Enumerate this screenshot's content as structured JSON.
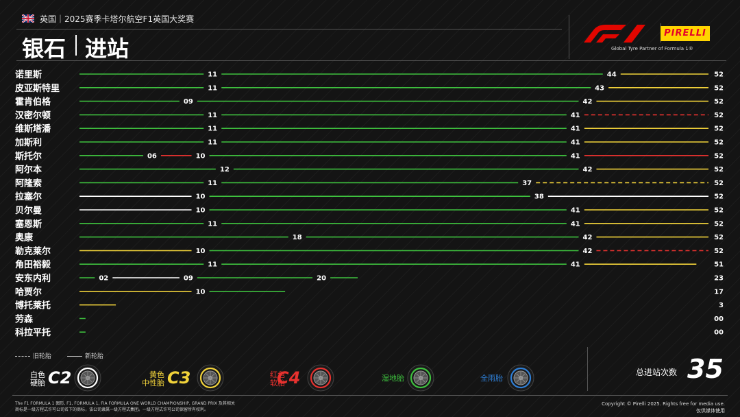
{
  "header": {
    "subtitle": "英国｜2025赛季卡塔尔航空F1英国大奖赛",
    "title_left": "银石",
    "title_right": "进站",
    "partner_text": "Global Tyre Partner of Formula 1®",
    "pirelli_text": "PIRELLI"
  },
  "colors": {
    "hard": "#ffffff",
    "medium": "#f2d33a",
    "soft": "#e8322f",
    "intermediate": "#3ec13e",
    "wet": "#2f7fd6"
  },
  "chart_data": {
    "type": "bar",
    "total_laps": 52,
    "drivers": [
      {
        "name": "诺里斯",
        "end": "52",
        "stints": [
          {
            "from": 0,
            "to": 11,
            "compound": "intermediate",
            "used": false
          },
          {
            "from": 11,
            "to": 44,
            "compound": "intermediate",
            "used": false
          },
          {
            "from": 44,
            "to": 52,
            "compound": "medium",
            "used": false
          }
        ],
        "marks": [
          "11",
          "44"
        ]
      },
      {
        "name": "皮亚斯特里",
        "end": "52",
        "stints": [
          {
            "from": 0,
            "to": 11,
            "compound": "intermediate",
            "used": false
          },
          {
            "from": 11,
            "to": 43,
            "compound": "intermediate",
            "used": false
          },
          {
            "from": 43,
            "to": 52,
            "compound": "medium",
            "used": false
          }
        ],
        "marks": [
          "11",
          "43"
        ]
      },
      {
        "name": "霍肯伯格",
        "end": "52",
        "stints": [
          {
            "from": 0,
            "to": 9,
            "compound": "intermediate",
            "used": false
          },
          {
            "from": 9,
            "to": 42,
            "compound": "intermediate",
            "used": false
          },
          {
            "from": 42,
            "to": 52,
            "compound": "medium",
            "used": false
          }
        ],
        "marks": [
          "09",
          "42"
        ]
      },
      {
        "name": "汉密尔顿",
        "end": "52",
        "stints": [
          {
            "from": 0,
            "to": 11,
            "compound": "intermediate",
            "used": false
          },
          {
            "from": 11,
            "to": 41,
            "compound": "intermediate",
            "used": false
          },
          {
            "from": 41,
            "to": 52,
            "compound": "soft",
            "used": true
          }
        ],
        "marks": [
          "11",
          "41"
        ]
      },
      {
        "name": "维斯塔潘",
        "end": "52",
        "stints": [
          {
            "from": 0,
            "to": 11,
            "compound": "intermediate",
            "used": false
          },
          {
            "from": 11,
            "to": 41,
            "compound": "intermediate",
            "used": false
          },
          {
            "from": 41,
            "to": 52,
            "compound": "medium",
            "used": false
          }
        ],
        "marks": [
          "11",
          "41"
        ]
      },
      {
        "name": "加斯利",
        "end": "52",
        "stints": [
          {
            "from": 0,
            "to": 11,
            "compound": "intermediate",
            "used": false
          },
          {
            "from": 11,
            "to": 41,
            "compound": "intermediate",
            "used": false
          },
          {
            "from": 41,
            "to": 52,
            "compound": "medium",
            "used": false
          }
        ],
        "marks": [
          "11",
          "41"
        ]
      },
      {
        "name": "斯托尔",
        "end": "52",
        "stints": [
          {
            "from": 0,
            "to": 6,
            "compound": "intermediate",
            "used": false
          },
          {
            "from": 6,
            "to": 10,
            "compound": "soft",
            "used": false
          },
          {
            "from": 10,
            "to": 41,
            "compound": "intermediate",
            "used": false
          },
          {
            "from": 41,
            "to": 52,
            "compound": "soft",
            "used": false
          }
        ],
        "marks": [
          "06",
          "10",
          "41"
        ]
      },
      {
        "name": "阿尔本",
        "end": "52",
        "stints": [
          {
            "from": 0,
            "to": 12,
            "compound": "intermediate",
            "used": false
          },
          {
            "from": 12,
            "to": 42,
            "compound": "intermediate",
            "used": false
          },
          {
            "from": 42,
            "to": 52,
            "compound": "medium",
            "used": false
          }
        ],
        "marks": [
          "12",
          "42"
        ]
      },
      {
        "name": "阿隆索",
        "end": "52",
        "stints": [
          {
            "from": 0,
            "to": 11,
            "compound": "intermediate",
            "used": false
          },
          {
            "from": 11,
            "to": 37,
            "compound": "intermediate",
            "used": false
          },
          {
            "from": 37,
            "to": 52,
            "compound": "medium",
            "used": true
          }
        ],
        "marks": [
          "11",
          "37"
        ]
      },
      {
        "name": "拉塞尔",
        "end": "52",
        "stints": [
          {
            "from": 0,
            "to": 10,
            "compound": "hard",
            "used": false
          },
          {
            "from": 10,
            "to": 38,
            "compound": "intermediate",
            "used": false
          },
          {
            "from": 38,
            "to": 52,
            "compound": "hard",
            "used": false
          }
        ],
        "marks": [
          "10",
          "38"
        ]
      },
      {
        "name": "贝尔曼",
        "end": "52",
        "stints": [
          {
            "from": 0,
            "to": 10,
            "compound": "hard",
            "used": false
          },
          {
            "from": 10,
            "to": 41,
            "compound": "intermediate",
            "used": false
          },
          {
            "from": 41,
            "to": 52,
            "compound": "medium",
            "used": false
          }
        ],
        "marks": [
          "10",
          "41"
        ]
      },
      {
        "name": "塞恩斯",
        "end": "52",
        "stints": [
          {
            "from": 0,
            "to": 11,
            "compound": "intermediate",
            "used": false
          },
          {
            "from": 11,
            "to": 41,
            "compound": "intermediate",
            "used": false
          },
          {
            "from": 41,
            "to": 52,
            "compound": "medium",
            "used": false
          }
        ],
        "marks": [
          "11",
          "41"
        ]
      },
      {
        "name": "奥康",
        "end": "52",
        "stints": [
          {
            "from": 0,
            "to": 18,
            "compound": "intermediate",
            "used": false
          },
          {
            "from": 18,
            "to": 42,
            "compound": "intermediate",
            "used": false
          },
          {
            "from": 42,
            "to": 52,
            "compound": "medium",
            "used": false
          }
        ],
        "marks": [
          "18",
          "42"
        ]
      },
      {
        "name": "勒克莱尔",
        "end": "52",
        "stints": [
          {
            "from": 0,
            "to": 10,
            "compound": "medium",
            "used": false
          },
          {
            "from": 10,
            "to": 42,
            "compound": "intermediate",
            "used": false
          },
          {
            "from": 42,
            "to": 52,
            "compound": "soft",
            "used": true
          }
        ],
        "marks": [
          "10",
          "42"
        ]
      },
      {
        "name": "角田裕毅",
        "end": "51",
        "stints": [
          {
            "from": 0,
            "to": 11,
            "compound": "intermediate",
            "used": false
          },
          {
            "from": 11,
            "to": 41,
            "compound": "intermediate",
            "used": false
          },
          {
            "from": 41,
            "to": 51,
            "compound": "medium",
            "used": false
          }
        ],
        "marks": [
          "11",
          "41"
        ]
      },
      {
        "name": "安东内利",
        "end": "23",
        "stints": [
          {
            "from": 0,
            "to": 2,
            "compound": "intermediate",
            "used": false
          },
          {
            "from": 2,
            "to": 9,
            "compound": "hard",
            "used": false
          },
          {
            "from": 9,
            "to": 20,
            "compound": "intermediate",
            "used": false
          },
          {
            "from": 20,
            "to": 23,
            "compound": "intermediate",
            "used": false
          }
        ],
        "marks": [
          "02",
          "09",
          "20"
        ]
      },
      {
        "name": "哈贾尔",
        "end": "17",
        "stints": [
          {
            "from": 0,
            "to": 10,
            "compound": "medium",
            "used": false
          },
          {
            "from": 10,
            "to": 17,
            "compound": "intermediate",
            "used": false
          }
        ],
        "marks": [
          "10"
        ]
      },
      {
        "name": "博托莱托",
        "end": "3",
        "stints": [
          {
            "from": 0,
            "to": 3,
            "compound": "medium",
            "used": false
          }
        ],
        "marks": []
      },
      {
        "name": "劳森",
        "end": "00",
        "stints": [
          {
            "from": 0,
            "to": 0.5,
            "compound": "intermediate",
            "used": false
          }
        ],
        "marks": []
      },
      {
        "name": "科拉平托",
        "end": "00",
        "stints": [
          {
            "from": 0,
            "to": 0.5,
            "compound": "intermediate",
            "used": false
          }
        ],
        "marks": []
      }
    ]
  },
  "legend": {
    "used": "旧轮胎",
    "new": "新轮胎",
    "tyres": [
      {
        "label_line1": "白色",
        "label_line2": "硬胎",
        "code": "C2",
        "color": "#ffffff"
      },
      {
        "label_line1": "黄色",
        "label_line2": "中性胎",
        "code": "C3",
        "color": "#f2d33a"
      },
      {
        "label_line1": "红色",
        "label_line2": "软胎",
        "code": "C4",
        "color": "#e8322f"
      },
      {
        "label_line1": "",
        "label_line2": "湿地胎",
        "code": "",
        "color": "#3ec13e"
      },
      {
        "label_line1": "",
        "label_line2": "全雨胎",
        "code": "",
        "color": "#2f7fd6"
      }
    ]
  },
  "summary": {
    "total_stops_label": "总进站次数",
    "total_stops": "35"
  },
  "footer": {
    "left_line1": "The F1 FORMULA 1 图形, F1, FORMULA 1, FIA FORMULA ONE WORLD CHAMPIONSHIP, GRAND PRIX 及其相关",
    "left_line2": "商标是一级方程式许可公司名下的商标，该公司隶属一级方程式集团。一级方程式许可公司保留所有权利。",
    "right_line1": "Copyright © Pirelli 2025. Rights free for media use.",
    "right_line2": "仅供媒体使用"
  }
}
